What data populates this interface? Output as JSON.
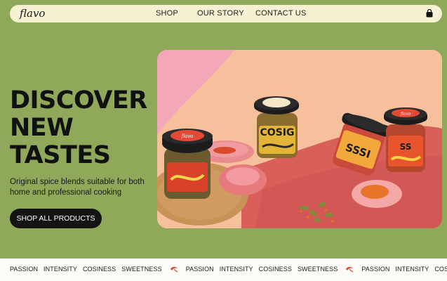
{
  "header": {
    "logo": "flavo",
    "nav": [
      {
        "label": "SHOP"
      },
      {
        "label": "OUR STORY"
      },
      {
        "label": "CONTACT US"
      }
    ],
    "cart_icon": "shopping-bag-icon"
  },
  "hero": {
    "title_lines": [
      "DISCOVER",
      "NEW",
      "TASTES"
    ],
    "subtitle": "Original spice blends suitable for both home and professional cooking",
    "cta_label": "SHOP ALL PRODUCTS",
    "jar_labels": [
      "flavo",
      "COSIG",
      "SSSI",
      "flavo"
    ]
  },
  "ticker": {
    "words": [
      "PASSION",
      "INTENSITY",
      "COSINESS",
      "SWEETNESS"
    ],
    "separator_icon": "chili-pepper-icon"
  },
  "colors": {
    "background": "#8fa85a",
    "nav_bg": "#f7f1d3",
    "button_bg": "#141414",
    "ticker_bg": "#fcfbf7",
    "accent_red": "#d9412b"
  }
}
